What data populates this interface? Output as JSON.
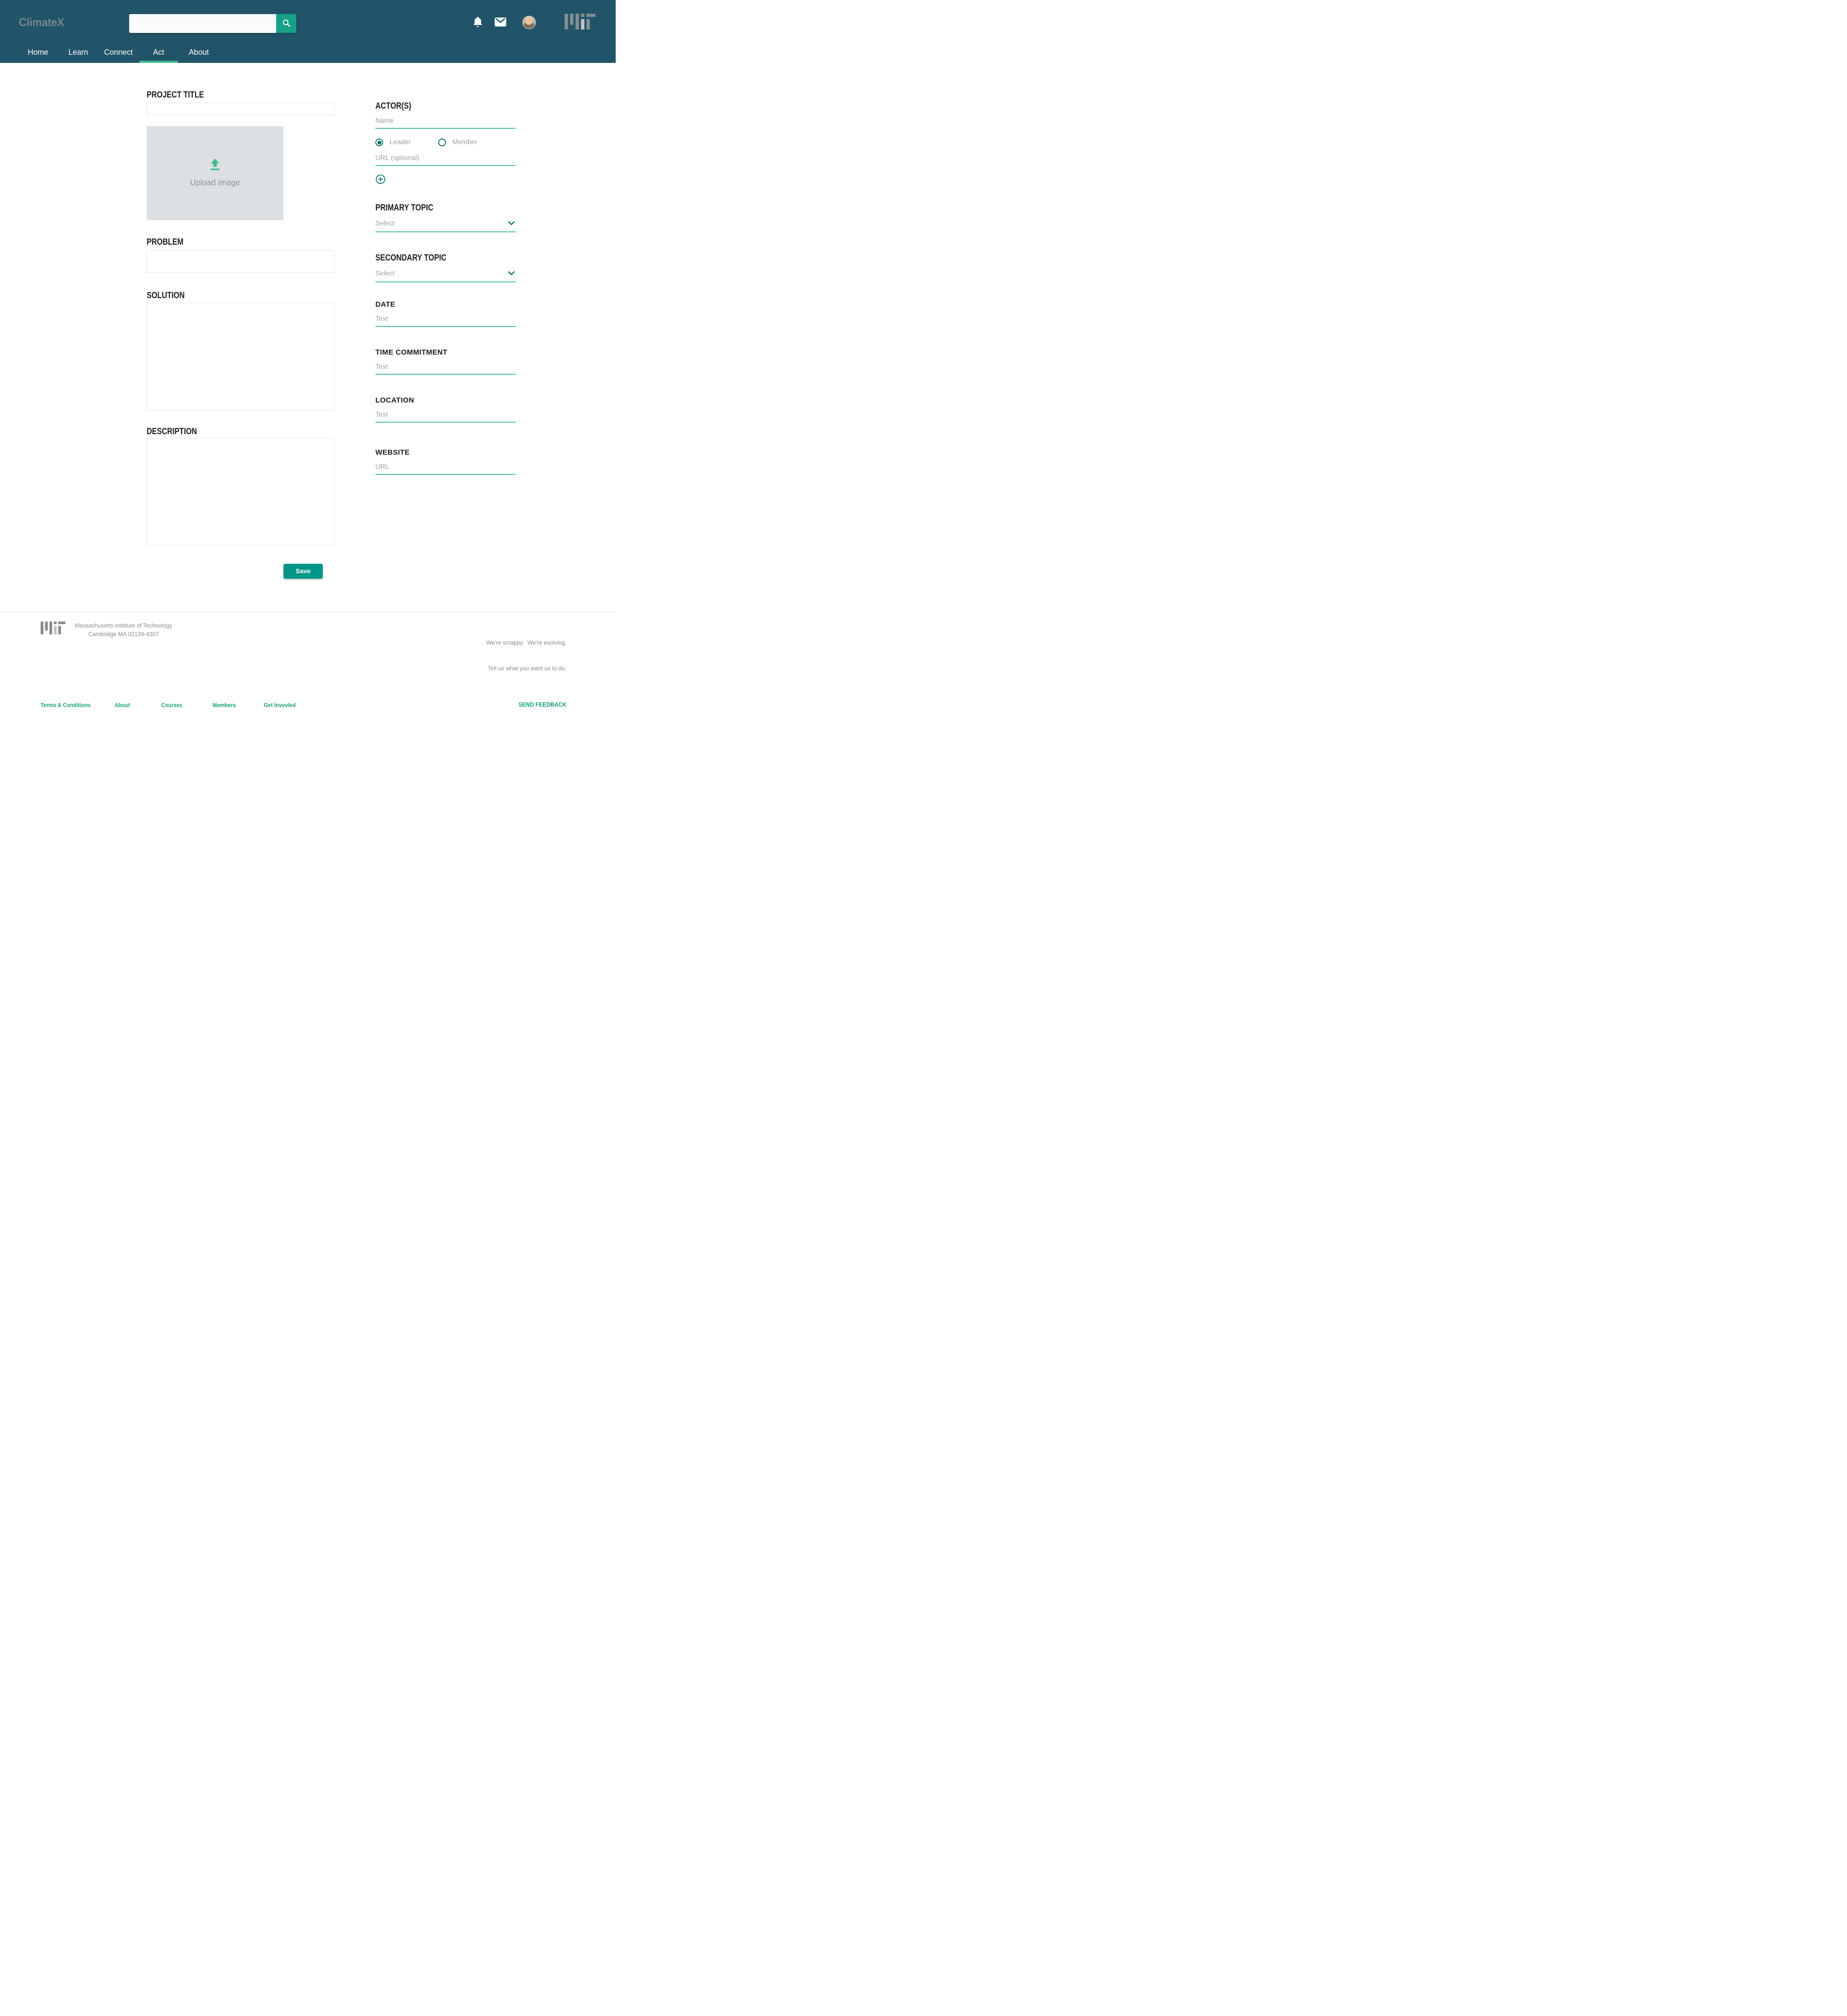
{
  "header": {
    "logo_text": "ClimateX",
    "search": {
      "value": ""
    },
    "nav": [
      {
        "label": "Home",
        "active": false
      },
      {
        "label": "Learn",
        "active": false
      },
      {
        "label": "Connect",
        "active": false
      },
      {
        "label": "Act",
        "active": true
      },
      {
        "label": "About",
        "active": false
      }
    ]
  },
  "icons": {
    "search": "magnifier",
    "notifications": "bell",
    "messages": "envelope",
    "avatar": "user-photo",
    "upload": "arrow-up-from-line",
    "add_actor": "plus-circle",
    "dropdown": "chevron-down",
    "brand_mark": "mit-logo-bars"
  },
  "form": {
    "left": {
      "project_title_label": "PROJECT TITLE",
      "project_title_value": "",
      "upload_label": "Upload image",
      "problem_label": "PROBLEM",
      "problem_value": "",
      "solution_label": "SOLUTION",
      "solution_value": "",
      "description_label": "DESCRIPTION",
      "description_value": "",
      "save_label": "Save"
    },
    "right": {
      "actors_label": "ACTOR(S)",
      "name_placeholder": "Name",
      "roles": [
        {
          "label": "Leader",
          "selected": true
        },
        {
          "label": "Member",
          "selected": false
        }
      ],
      "url_placeholder": "URL (optional)",
      "primary_topic": {
        "label": "PRIMARY TOPIC",
        "value": "Select"
      },
      "secondary_topic": {
        "label": "SECONDARY TOPIC",
        "value": "Select"
      },
      "date": {
        "label": "DATE",
        "placeholder": "Text",
        "value": ""
      },
      "time_commitment": {
        "label": "TIME COMMITMENT",
        "placeholder": "Text",
        "value": ""
      },
      "location": {
        "label": "LOCATION",
        "placeholder": "Text",
        "value": ""
      },
      "website": {
        "label": "WEBSITE",
        "placeholder": "URL",
        "value": ""
      }
    }
  },
  "footer": {
    "institution_line1": "Massachusetts Institute of Technology",
    "institution_line2": "Cambridge MA 02139-4307",
    "tagline_line1": "We're scrappy.  We're evolving.",
    "tagline_line2": "Tell us what you want us to do.",
    "links": [
      {
        "label": "Terms & Conditions"
      },
      {
        "label": "About"
      },
      {
        "label": "Courses"
      },
      {
        "label": "Members"
      },
      {
        "label": "Get Invovled"
      }
    ],
    "send_feedback_label": "SEND FEEDBACK"
  },
  "colors": {
    "header_bg": "#215468",
    "search_button_green": "#16a085",
    "active_tab_green": "#43be8e",
    "field_underline_green": "#3ebe8f",
    "dark_green": "#00695c",
    "save_teal": "#009688",
    "footer_link_green": "#21a179",
    "upload_box_gray": "#dce0e3",
    "placeholder_gray": "#9aa0a5"
  }
}
